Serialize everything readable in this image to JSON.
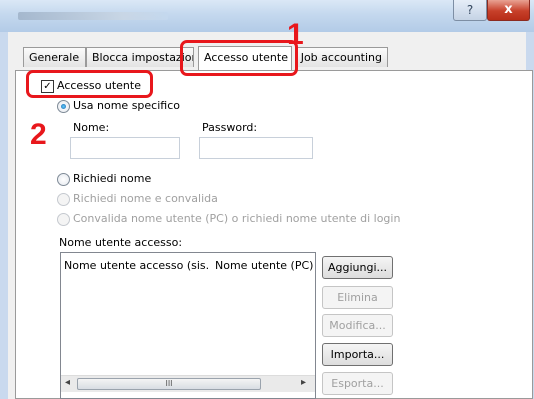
{
  "window": {
    "help_glyph": "?",
    "close_glyph": "x"
  },
  "tabs": [
    {
      "label": "Generale"
    },
    {
      "label": "Blocca impostazioni"
    },
    {
      "label": "Accesso utente"
    },
    {
      "label": "Job accounting"
    }
  ],
  "user_login": {
    "checkbox_label": "Accesso utente",
    "checked": true,
    "check_glyph": "✓",
    "use_specific_name": "Usa nome specifico",
    "name_label": "Nome:",
    "name_value": "",
    "password_label": "Password:",
    "password_value": "",
    "prompt_name": "Richiedi nome",
    "prompt_name_validate": "Richiedi nome e convalida",
    "validate_pc": "Convalida nome utente (PC) o richiedi nome utente di login"
  },
  "login_list": {
    "title": "Nome utente accesso:",
    "columns": [
      "Nome utente accesso (sis...",
      "Nome utente (PC)"
    ],
    "rows": [],
    "scroll_left_glyph": "◂",
    "scroll_right_glyph": "▸",
    "scroll_grip_glyph": "III"
  },
  "buttons": {
    "add": "Aggiungi...",
    "delete": "Elimina",
    "edit": "Modifica...",
    "import": "Importa...",
    "export": "Esporta..."
  },
  "callouts": {
    "step1": "1",
    "step2": "2",
    "color": "#e8171c"
  }
}
